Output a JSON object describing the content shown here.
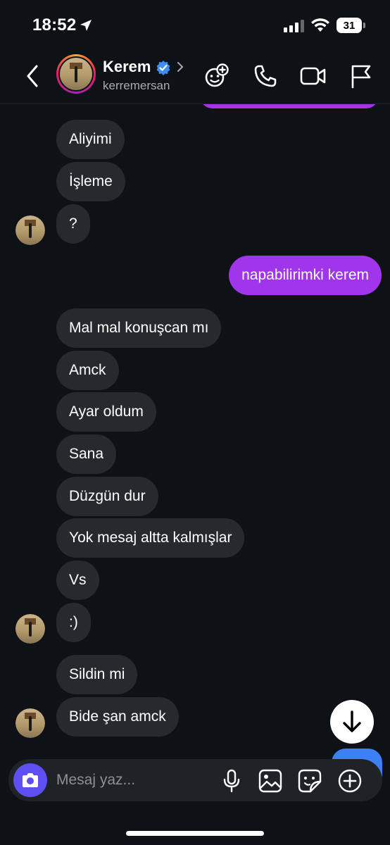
{
  "status": {
    "time": "18:52",
    "battery": "31"
  },
  "header": {
    "name": "Kerem",
    "username": "kerremersan"
  },
  "messages": [
    {
      "text": "Aliyimi",
      "from": "them"
    },
    {
      "text": "İşleme",
      "from": "them"
    },
    {
      "text": "?",
      "from": "them"
    },
    {
      "text": "napabilirimki kerem",
      "from": "me"
    },
    {
      "text": "Mal mal konuşcan mı",
      "from": "them"
    },
    {
      "text": "Amck",
      "from": "them"
    },
    {
      "text": "Ayar oldum",
      "from": "them"
    },
    {
      "text": "Sana",
      "from": "them"
    },
    {
      "text": "Düzgün dur",
      "from": "them"
    },
    {
      "text": "Yok mesaj altta kalmışlar",
      "from": "them"
    },
    {
      "text": "Vs",
      "from": "them"
    },
    {
      "text": ":)",
      "from": "them"
    },
    {
      "text": "Sildin mi",
      "from": "them"
    },
    {
      "text": "Bide şan amck",
      "from": "them"
    }
  ],
  "composer": {
    "placeholder": "Mesaj yaz..."
  },
  "colors": {
    "sent_bubble": "#a035ec",
    "received_bubble": "#26292e",
    "camera_button": "#5d4ff1",
    "verified": "#3d8df5"
  },
  "icons": [
    "location-arrow-icon",
    "wifi-icon",
    "back-chevron-icon",
    "verified-icon",
    "chevron-right-icon",
    "effects-icon",
    "phone-icon",
    "video-icon",
    "flag-icon",
    "camera-icon",
    "mic-icon",
    "gallery-icon",
    "sticker-icon",
    "plus-icon",
    "arrow-down-icon"
  ]
}
